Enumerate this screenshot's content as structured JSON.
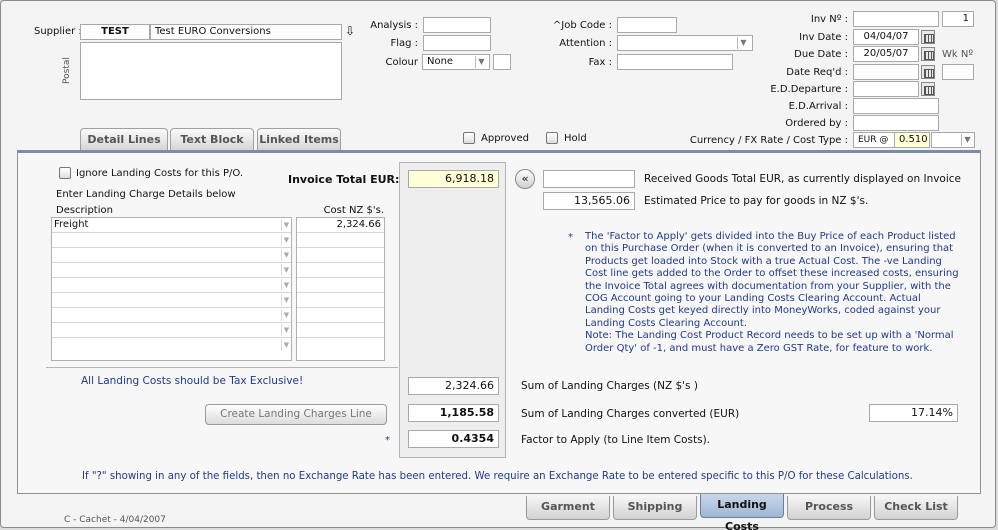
{
  "header": {
    "supplier_label": "Supplier :",
    "supplier_code": "TEST",
    "supplier_name": "Test EURO Conversions",
    "postal_label": "Postal",
    "analysis_label": "Analysis :",
    "analysis_value": "",
    "flag_label": "Flag :",
    "flag_value": "",
    "colour_label": "Colour",
    "colour_value": "None",
    "job_code_label": "^Job Code :",
    "job_code_value": "",
    "attention_label": "Attention :",
    "attention_value": "",
    "fax_label": "Fax :",
    "fax_value": "",
    "inv_no_label": "Inv Nº :",
    "inv_no_value": "",
    "inv_no_extra": "1",
    "inv_date_label": "Inv Date :",
    "inv_date_value": "04/04/07",
    "due_date_label": "Due Date :",
    "due_date_value": "20/05/07",
    "wk_label": "Wk Nº",
    "date_reqd_label": "Date Req'd :",
    "date_reqd_value": "",
    "ed_departure_label": "E.D.Departure :",
    "ed_departure_value": "",
    "ed_arrival_label": "E.D.Arrival :",
    "ed_arrival_value": "",
    "ordered_by_label": "Ordered by :",
    "ordered_by_value": "",
    "currency_label": "Currency / FX Rate / Cost Type :",
    "currency_value": "EUR @",
    "fx_rate": "0.510",
    "approved_label": "Approved",
    "hold_label": "Hold"
  },
  "top_tabs": [
    "Detail Lines",
    "Text Block",
    "Linked Items"
  ],
  "landing": {
    "ignore_label": "Ignore Landing Costs for this P/O.",
    "enter_label": "Enter Landing Charge Details below",
    "desc_header": "Description",
    "cost_header": "Cost NZ $'s.",
    "rows": [
      {
        "description": "Freight",
        "cost": "2,324.66"
      },
      {
        "description": "",
        "cost": ""
      },
      {
        "description": "",
        "cost": ""
      },
      {
        "description": "",
        "cost": ""
      },
      {
        "description": "",
        "cost": ""
      },
      {
        "description": "",
        "cost": ""
      },
      {
        "description": "",
        "cost": ""
      },
      {
        "description": "",
        "cost": ""
      },
      {
        "description": "",
        "cost": ""
      }
    ],
    "invoice_total_label": "Invoice Total EUR:",
    "invoice_total_value": "6,918.18",
    "received_value": "",
    "received_label": "Received Goods Total EUR, as currently displayed on Invoice",
    "estimated_value": "13,565.06",
    "estimated_label": "Estimated Price to pay for goods in NZ $'s.",
    "note_star": "*",
    "note_lines": [
      "The 'Factor to Apply' gets divided into the Buy Price of each Product listed",
      "on this Purchase Order (when it is converted to an Invoice), ensuring that",
      "Products get loaded into Stock with a true Actual Cost.  The -ve Landing",
      "Cost line gets added to the Order to offset these increased costs, ensuring",
      "the Invoice Total agrees with documentation from your Supplier, with the",
      "COG Account going to your Landing Costs Clearing Account.  Actual",
      "Landing Costs get keyed directly into MoneyWorks, coded against your",
      "Landing Costs Clearing Account.",
      "Note:  The Landing Cost Product Record needs to be set up with a 'Normal",
      "Order Qty' of -1, and must have a Zero GST Rate, for feature to work."
    ],
    "tax_exclusive_note": "All Landing Costs should be Tax Exclusive!",
    "create_button": "Create Landing Charges Line",
    "sum_nz_value": "2,324.66",
    "sum_nz_label": "Sum of Landing Charges (NZ $'s )",
    "sum_eur_value": "1,185.58",
    "sum_eur_label": "Sum of Landing Charges converted (EUR)",
    "percent_value": "17.14%",
    "factor_star": "*",
    "factor_value": "0.4354",
    "factor_label": "Factor to Apply (to Line Item Costs).",
    "footer_note": "If \"?\" showing in any of the fields, then no Exchange Rate has been entered.  We require an Exchange Rate to be entered specific to this P/O for these Calculations."
  },
  "bottom_tabs": [
    {
      "label": "Garment",
      "active": false
    },
    {
      "label": "Shipping",
      "active": false
    },
    {
      "label": "Landing Costs",
      "active": true
    },
    {
      "label": "Process",
      "active": false
    },
    {
      "label": "Check List",
      "active": false
    }
  ],
  "status": "C - Cachet - 4/04/2007",
  "icons": {
    "supplier_lookup": "download-arrow-icon",
    "calendar": "calendar-icon",
    "back": "double-chevron-left-icon"
  },
  "colors": {
    "highlight_field": "#ffffd8",
    "note_text": "#1f3a8a",
    "active_tab": "#a9bdd7"
  }
}
